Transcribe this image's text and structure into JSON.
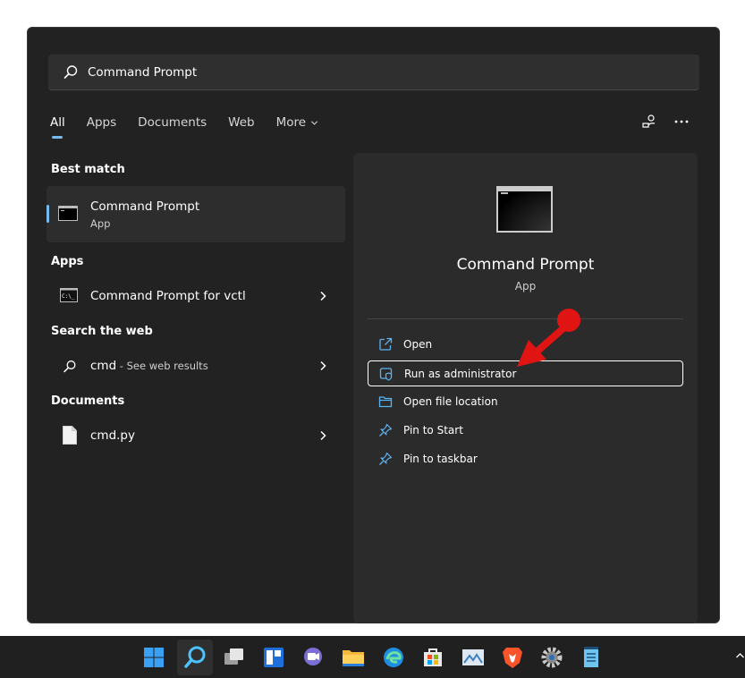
{
  "search": {
    "value": "Command Prompt",
    "placeholder": "Command Prompt"
  },
  "tabs": [
    {
      "label": "All"
    },
    {
      "label": "Apps"
    },
    {
      "label": "Documents"
    },
    {
      "label": "Web"
    },
    {
      "label": "More"
    }
  ],
  "sections": {
    "best_match": "Best match",
    "apps": "Apps",
    "search_web": "Search the web",
    "documents": "Documents"
  },
  "best_match": {
    "title": "Command Prompt",
    "subtitle": "App"
  },
  "apps_results": [
    {
      "label": "Command Prompt for vctl"
    }
  ],
  "web_results": [
    {
      "query": "cmd",
      "suffix": " - See web results"
    }
  ],
  "document_results": [
    {
      "label": "cmd.py"
    }
  ],
  "detail": {
    "title": "Command Prompt",
    "subtitle": "App",
    "actions": [
      {
        "label": "Open",
        "icon": "open-icon"
      },
      {
        "label": "Run as administrator",
        "icon": "shield-icon"
      },
      {
        "label": "Open file location",
        "icon": "folder-icon"
      },
      {
        "label": "Pin to Start",
        "icon": "pin-icon"
      },
      {
        "label": "Pin to taskbar",
        "icon": "pin-icon"
      }
    ]
  },
  "colors": {
    "accent": "#76b9ed",
    "panel": "#222222",
    "annotation": "#e11414"
  },
  "taskbar": [
    "start-icon",
    "search-icon",
    "task-view-icon",
    "widgets-icon",
    "chat-icon",
    "file-explorer-icon",
    "edge-icon",
    "store-icon",
    "photos-icon",
    "brave-icon",
    "settings-icon",
    "notepad-icon"
  ]
}
